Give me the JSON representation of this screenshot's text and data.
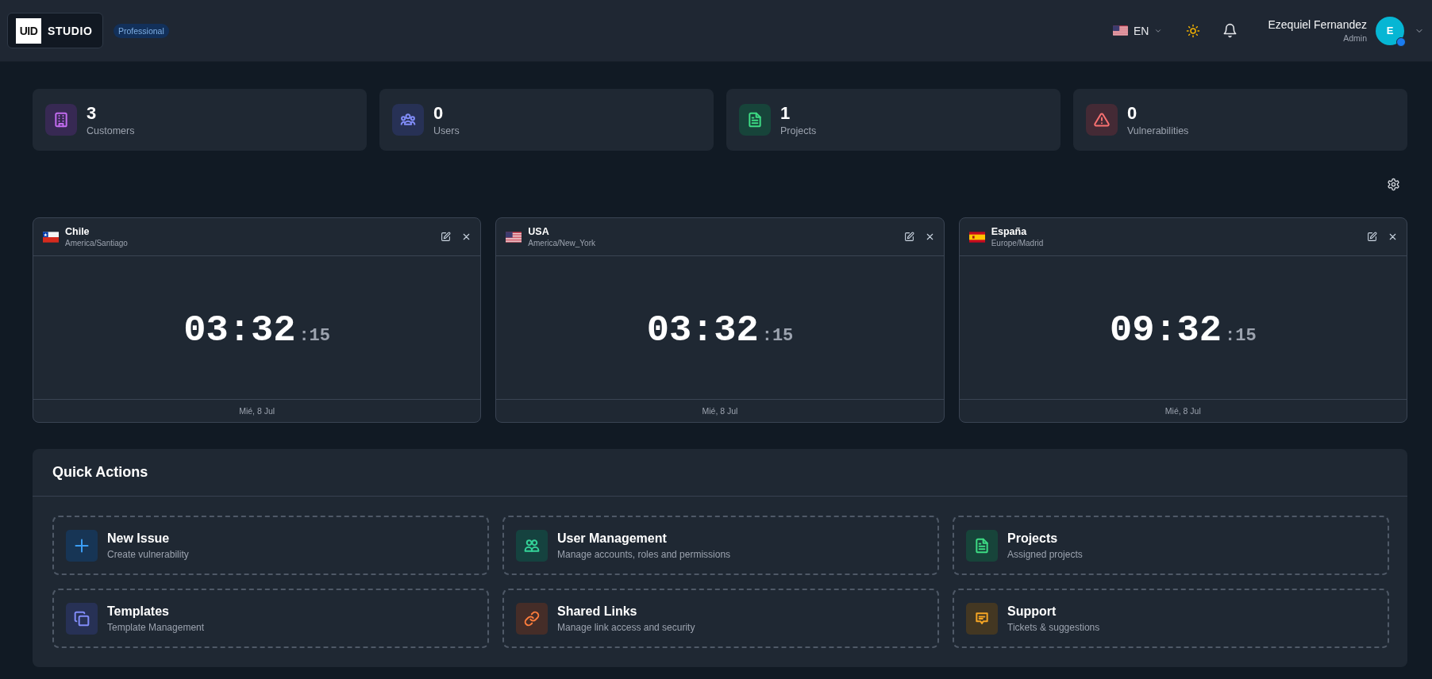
{
  "header": {
    "logo": {
      "mark": "UID",
      "text": "STUDIO"
    },
    "plan_badge": "Professional",
    "language": {
      "code": "EN"
    },
    "user": {
      "name": "Ezequiel Fernandez",
      "role": "Admin",
      "initial": "E",
      "online": true
    }
  },
  "stats": [
    {
      "kind": "building",
      "value": "3",
      "label": "Customers",
      "color": "#c26cf0"
    },
    {
      "kind": "group",
      "value": "0",
      "label": "Users",
      "color": "#818cf8"
    },
    {
      "kind": "document",
      "value": "1",
      "label": "Projects",
      "color": "#3ddc84"
    },
    {
      "kind": "warning",
      "value": "0",
      "label": "Vulnerabilities",
      "color": "#f87171"
    }
  ],
  "clocks": [
    {
      "kind": "cl",
      "country": "Chile",
      "timezone": "America/Santiago",
      "time": "03:32",
      "seconds": ":15",
      "date": "Mié, 8 Jul"
    },
    {
      "kind": "us",
      "country": "USA",
      "timezone": "America/New_York",
      "time": "03:32",
      "seconds": ":15",
      "date": "Mié, 8 Jul"
    },
    {
      "kind": "es",
      "country": "España",
      "timezone": "Europe/Madrid",
      "time": "09:32",
      "seconds": ":15",
      "date": "Mié, 8 Jul"
    }
  ],
  "quick_actions": {
    "title": "Quick Actions",
    "items": [
      {
        "kind": "plus",
        "title": "New Issue",
        "subtitle": "Create vulnerability",
        "color": "#3b9ef5"
      },
      {
        "kind": "people",
        "title": "User Management",
        "subtitle": "Manage accounts, roles and permissions",
        "color": "#34d399"
      },
      {
        "kind": "document",
        "title": "Projects",
        "subtitle": "Assigned projects",
        "color": "#3ddc84"
      },
      {
        "kind": "copy",
        "title": "Templates",
        "subtitle": "Template Management",
        "color": "#818cf8"
      },
      {
        "kind": "link",
        "title": "Shared Links",
        "subtitle": "Manage link access and security",
        "color": "#fb7c3c"
      },
      {
        "kind": "chat",
        "title": "Support",
        "subtitle": "Tickets & suggestions",
        "color": "#f5a524"
      }
    ]
  }
}
